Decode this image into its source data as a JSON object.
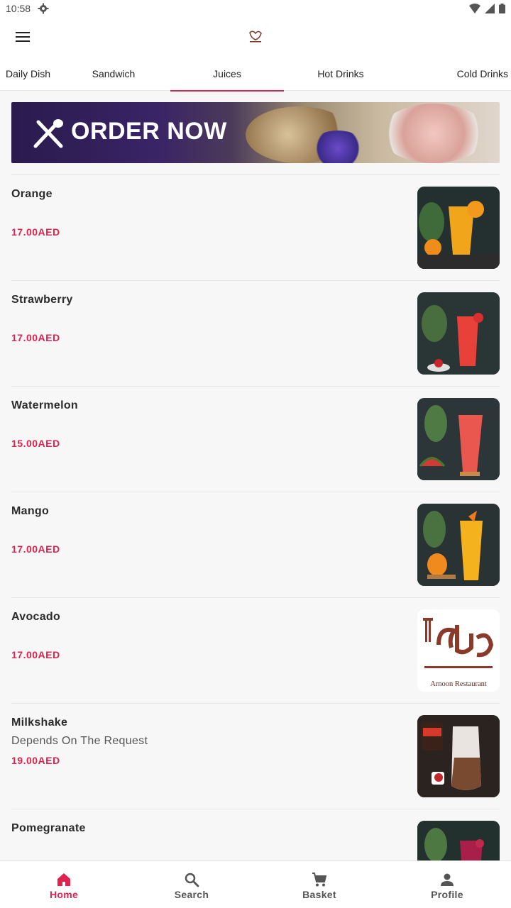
{
  "status_bar": {
    "time": "10:58"
  },
  "tabs": [
    {
      "label": "Daily Dish"
    },
    {
      "label": "Sandwich"
    },
    {
      "label": "Juices"
    },
    {
      "label": "Hot Drinks"
    },
    {
      "label": "Cold Drinks"
    }
  ],
  "banner": {
    "text": "ORDER NOW"
  },
  "items": [
    {
      "name": "Orange",
      "desc": "",
      "price": "17.00AED"
    },
    {
      "name": "Strawberry",
      "desc": "",
      "price": "17.00AED"
    },
    {
      "name": "Watermelon",
      "desc": "",
      "price": "15.00AED"
    },
    {
      "name": "Mango",
      "desc": "",
      "price": "17.00AED"
    },
    {
      "name": "Avocado",
      "desc": "",
      "price": "17.00AED"
    },
    {
      "name": "Milkshake",
      "desc": "Depends On The Request",
      "price": "19.00AED"
    },
    {
      "name": "Pomegranate",
      "desc": "",
      "price": ""
    }
  ],
  "placeholder_logo": {
    "latin": "Arnoon Restaurant"
  },
  "bottom_nav": [
    {
      "label": "Home"
    },
    {
      "label": "Search"
    },
    {
      "label": "Basket"
    },
    {
      "label": "Profile"
    }
  ],
  "colors": {
    "accent": "#e0224e",
    "background": "#f7f7f7",
    "text": "#2b2b2b"
  }
}
